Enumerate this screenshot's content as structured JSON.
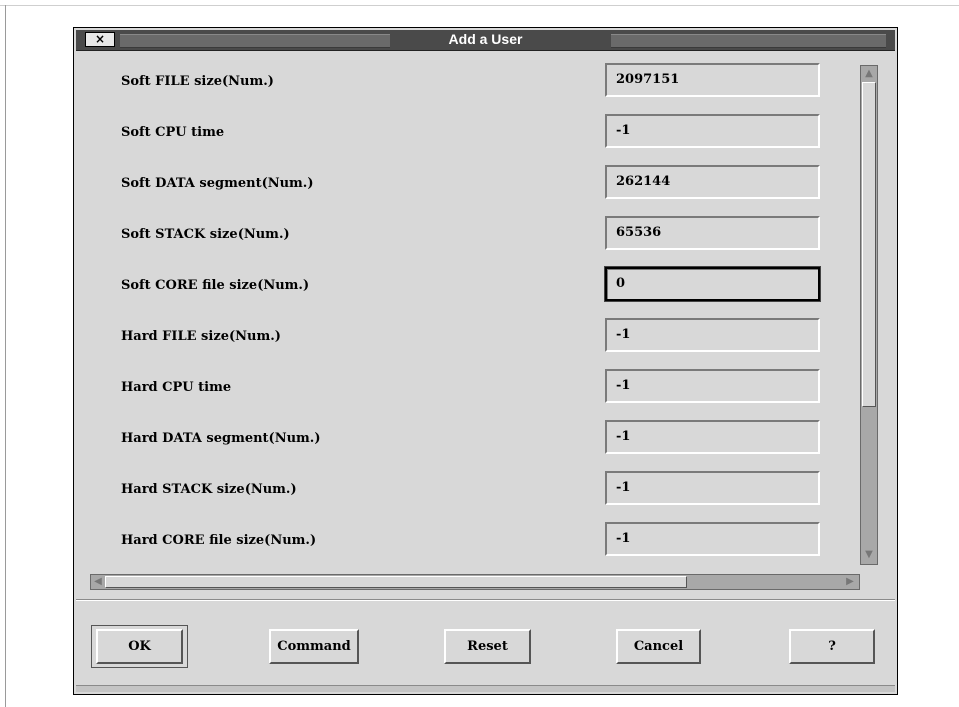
{
  "window": {
    "title": "Add a User",
    "close_glyph": "×"
  },
  "fields": [
    {
      "label": "Soft FILE size(Num.)",
      "value": "2097151"
    },
    {
      "label": "Soft CPU time",
      "value": "-1"
    },
    {
      "label": "Soft DATA segment(Num.)",
      "value": "262144"
    },
    {
      "label": "Soft STACK size(Num.)",
      "value": "65536"
    },
    {
      "label": "Soft CORE file size(Num.)",
      "value": "0",
      "focused": true
    },
    {
      "label": "Hard FILE size(Num.)",
      "value": "-1"
    },
    {
      "label": "Hard CPU time",
      "value": "-1"
    },
    {
      "label": "Hard DATA segment(Num.)",
      "value": "-1"
    },
    {
      "label": "Hard STACK size(Num.)",
      "value": "-1"
    },
    {
      "label": "Hard CORE file size(Num.)",
      "value": "-1"
    }
  ],
  "scroll_arrows": {
    "up": "▲",
    "down": "▼",
    "left": "◀",
    "right": "▶"
  },
  "buttons": {
    "ok": "OK",
    "command": "Command",
    "reset": "Reset",
    "cancel": "Cancel",
    "help": "?"
  }
}
